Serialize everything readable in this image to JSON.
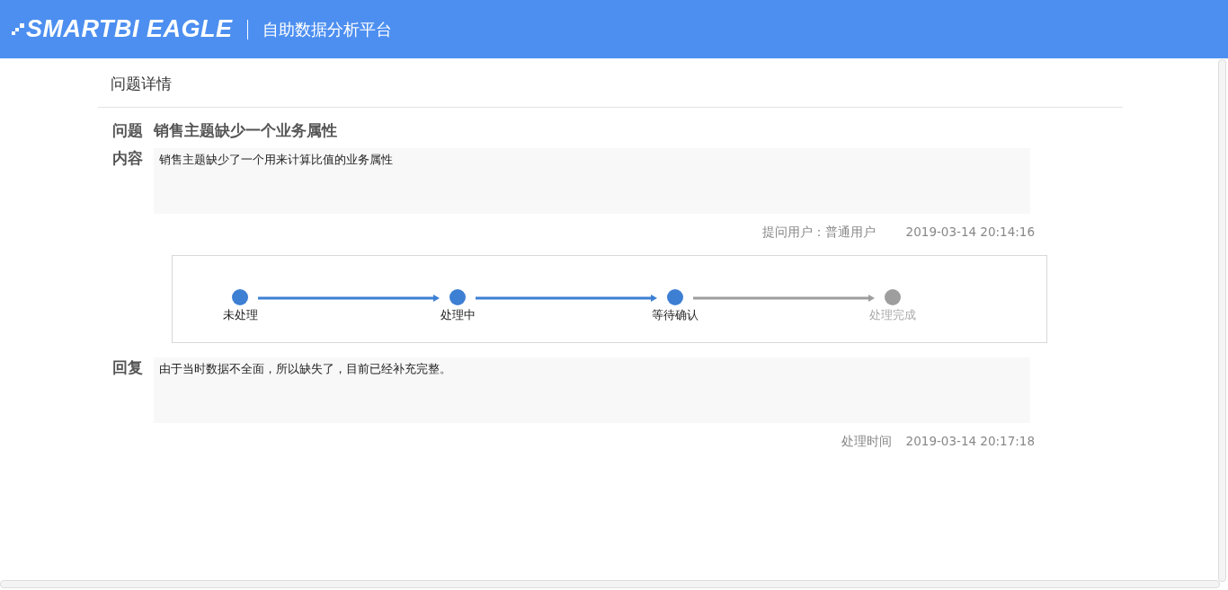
{
  "header": {
    "logo": "SMARTBI EAGLE",
    "subtitle": "自助数据分析平台"
  },
  "page_title": "问题详情",
  "question": {
    "label": "问题",
    "value": "销售主题缺少一个业务属性"
  },
  "content": {
    "label": "内容",
    "value": "销售主题缺少了一个用来计算比值的业务属性"
  },
  "submit_meta": {
    "user": "提问用户：普通用户",
    "time": "2019-03-14 20:14:16"
  },
  "steps": [
    {
      "label": "未处理",
      "done": true
    },
    {
      "label": "处理中",
      "done": true
    },
    {
      "label": "等待确认",
      "done": true
    },
    {
      "label": "处理完成",
      "done": false
    }
  ],
  "reply": {
    "label": "回复",
    "value": "由于当时数据不全面，所以缺失了，目前已经补充完整。"
  },
  "reply_meta": {
    "label": "处理时间",
    "time": "2019-03-14 20:17:18"
  }
}
